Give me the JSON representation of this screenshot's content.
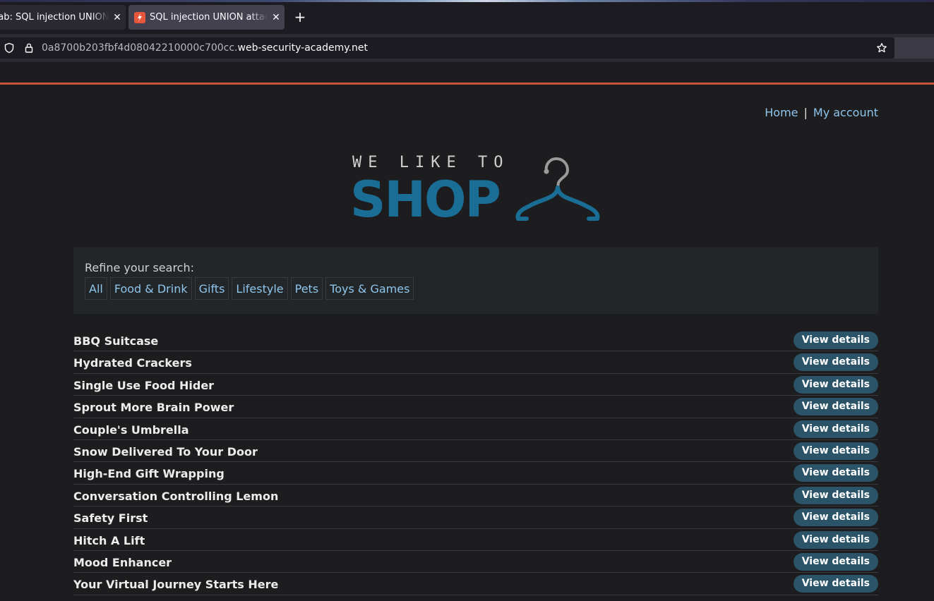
{
  "browser": {
    "tabs": [
      {
        "title": "Lab: SQL injection UNION attack, determining the number of columns",
        "active": false
      },
      {
        "title": "SQL injection UNION attack, determining the number of columns",
        "active": true
      }
    ],
    "tab_close_glyph": "✕",
    "new_tab_glyph": "+",
    "url": {
      "subdomain": "0a8700b203fbf4d08042210000c700cc.",
      "domain": "web-security-academy.net"
    }
  },
  "header": {
    "nav": [
      {
        "label": "Home"
      },
      {
        "label": "My account"
      }
    ],
    "separator": "|"
  },
  "logo": {
    "top_text": "WE LIKE TO",
    "main_text": "SHOP",
    "accent_color": "#1a6e96"
  },
  "search": {
    "label": "Refine your search:",
    "filters": [
      "All",
      "Food & Drink",
      "Gifts",
      "Lifestyle",
      "Pets",
      "Toys & Games"
    ]
  },
  "products": {
    "button_label": "View details",
    "items": [
      "BBQ Suitcase",
      "Hydrated Crackers",
      "Single Use Food Hider",
      "Sprout More Brain Power",
      "Couple's Umbrella",
      "Snow Delivered To Your Door",
      "High-End Gift Wrapping",
      "Conversation Controlling Lemon",
      "Safety First",
      "Hitch A Lift",
      "Mood Enhancer",
      "Your Virtual Journey Starts Here"
    ]
  },
  "colors": {
    "accent_orange": "#c8543a",
    "link_blue": "#8ec5ec",
    "button_bg": "#2b5468",
    "page_bg": "#1d1d1f"
  }
}
